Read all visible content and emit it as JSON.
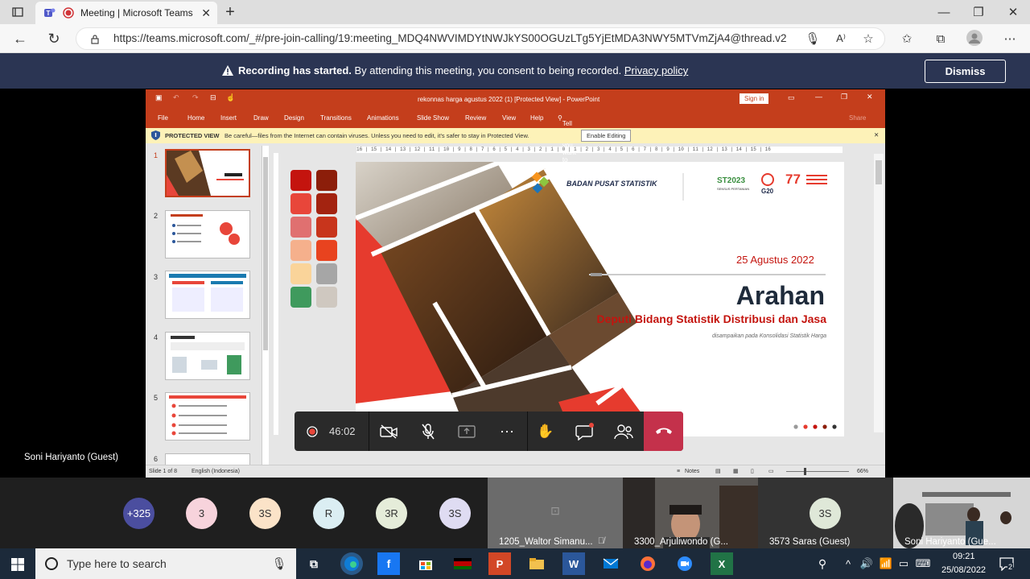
{
  "browser": {
    "tab_title": "Meeting | Microsoft Teams",
    "url": "https://teams.microsoft.com/_#/pre-join-calling/19:meeting_MDQ4NWVIMDYtNWJkYS00OGUzLTg5YjEtMDA3NWY5MTVmZjA4@thread.v2"
  },
  "banner": {
    "bold": "Recording has started.",
    "text": " By attending this meeting, you consent to being recorded. ",
    "link": "Privacy policy",
    "dismiss": "Dismiss"
  },
  "ppt": {
    "title": "rekonnas harga agustus 2022 (1) [Protected View]  -  PowerPoint",
    "sign_in": "Sign in",
    "share": "Share",
    "tell_me": "Tell me what you want to do",
    "menu": [
      "File",
      "Home",
      "Insert",
      "Draw",
      "Design",
      "Transitions",
      "Animations",
      "Slide Show",
      "Review",
      "View",
      "Help"
    ],
    "protected_label": "PROTECTED VIEW",
    "protected_text": "Be careful—files from the Internet can contain viruses. Unless you need to edit, it's safer to stay in Protected View.",
    "enable_editing": "Enable Editing",
    "ruler": "16 | 15 | 14 | 13 | 12 | 11 | 10 | 9 | 8 | 7 | 6 | 5 | 4 | 3 | 2 | 1 | 0 | 1 | 2 | 3 | 4 | 5 | 6 | 7 | 8 | 9 | 10 | 11 | 12 | 13 | 14 | 15 | 16",
    "thumb_numbers": [
      "1",
      "2",
      "3",
      "4",
      "5",
      "6"
    ],
    "status_slide": "Slide 1 of 8",
    "status_lang": "English (Indonesia)",
    "status_notes": "Notes",
    "zoom": "66%",
    "swatch_colors": [
      "#c4140e",
      "#8c1e0a",
      "#e8463a",
      "#a32310",
      "#e07070",
      "#c8351c",
      "#f5b08c",
      "#e8431f",
      "#fad49a",
      "#a6a6a6",
      "#3f9a5d",
      "#cfc8c0"
    ]
  },
  "slide": {
    "org": "BADAN PUSAT STATISTIK",
    "st2023": "ST2023",
    "st2023_sub": "SENSUS PERTANIAN",
    "g20": "G20",
    "ri77": "77",
    "date": "25 Agustus 2022",
    "title": "Arahan",
    "subtitle": "Deputi Bidang Statistik Distribusi dan Jasa",
    "note": "disampaikan pada Konsolidasi Statistik Harga"
  },
  "presenter_label": "Soni Hariyanto (Guest)",
  "controls": {
    "timer": "46:02"
  },
  "participants": {
    "avatars": [
      {
        "initials": "+325",
        "bg": "#4b4e9f",
        "fg": "#ffffff"
      },
      {
        "initials": "3",
        "bg": "#f7d3dc",
        "fg": "#333333"
      },
      {
        "initials": "3S",
        "bg": "#fbe3c8",
        "fg": "#333333"
      },
      {
        "initials": "R",
        "bg": "#dbeef3",
        "fg": "#333333"
      },
      {
        "initials": "3R",
        "bg": "#e5ecd9",
        "fg": "#333333"
      },
      {
        "initials": "3S",
        "bg": "#dfdcf2",
        "fg": "#333333"
      }
    ],
    "tiles": [
      {
        "name": "1205_Waltor Simanu..."
      },
      {
        "name": "3300_Arjuliwondo (G..."
      },
      {
        "name": "3573 Saras (Guest)",
        "initials": "3S"
      },
      {
        "name": "Soni Hariyanto (Gue..."
      }
    ]
  },
  "taskbar": {
    "search_placeholder": "Type here to search",
    "time": "09:21",
    "date": "25/08/2022",
    "notif_count": "2"
  }
}
